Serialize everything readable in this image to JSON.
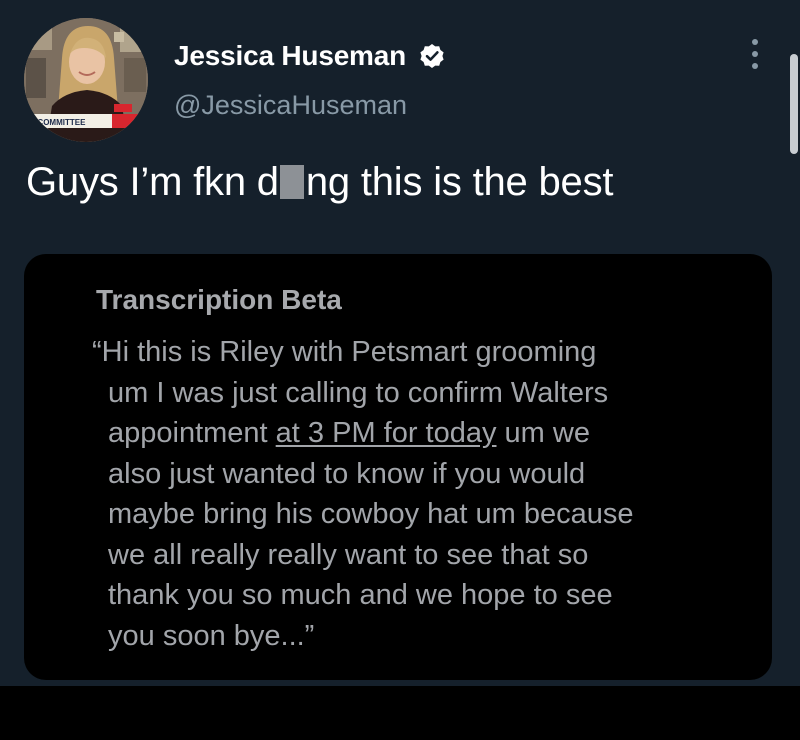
{
  "author": {
    "display_name": "Jessica Huseman",
    "handle": "@JessicaHuseman",
    "verified": true,
    "avatar_caption": "Y COMMITTEE"
  },
  "tweet": {
    "text_before": "Guys I’m fkn d",
    "text_after": "ng this is the best"
  },
  "card": {
    "title": "Transcription Beta",
    "lines": [
      "“Hi this is Riley with Petsmart grooming",
      "um I was just calling to confirm Walters",
      "also just wanted to know if you would",
      "maybe bring his cowboy hat um because",
      "we all really really want to see that so",
      "thank you so much and we hope to see",
      "you soon bye...”"
    ],
    "appointment_before": "appointment ",
    "appointment_link": "at 3 PM for today",
    "appointment_after": " um we"
  },
  "colors": {
    "background": "#15202b",
    "card_background": "#000000",
    "secondary_text": "#8899a6",
    "card_text": "#a2a5aa"
  },
  "icons": {
    "verified": "verified-badge-icon",
    "more": "more-vertical-icon"
  }
}
